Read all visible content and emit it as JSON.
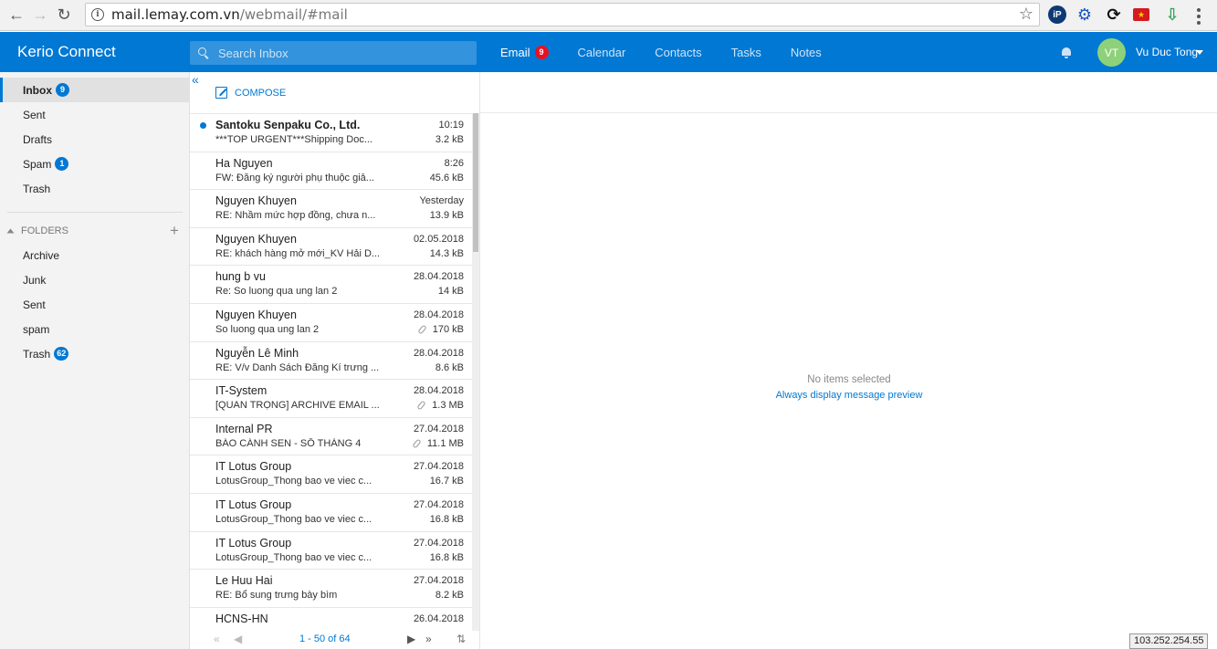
{
  "browser": {
    "url_host": "mail.lemay.com.vn",
    "url_path": "/webmail/#mail",
    "ext_ip_label": "iP"
  },
  "header": {
    "brand": "Kerio Connect",
    "search_placeholder": "Search Inbox",
    "tabs": [
      {
        "label": "Email",
        "badge": "9"
      },
      {
        "label": "Calendar"
      },
      {
        "label": "Contacts"
      },
      {
        "label": "Tasks"
      },
      {
        "label": "Notes"
      }
    ],
    "avatar_initials": "VT",
    "user_name": "Vu Duc Tong",
    "accent_color": "#0078d4"
  },
  "sidebar": {
    "mailboxes": [
      {
        "label": "Inbox",
        "badge": "9"
      },
      {
        "label": "Sent"
      },
      {
        "label": "Drafts"
      },
      {
        "label": "Spam",
        "badge": "1"
      },
      {
        "label": "Trash"
      }
    ],
    "folders_header": "FOLDERS",
    "folders": [
      {
        "label": "Archive"
      },
      {
        "label": "Junk"
      },
      {
        "label": "Sent"
      },
      {
        "label": "spam"
      },
      {
        "label": "Trash",
        "badge": "62"
      }
    ]
  },
  "list": {
    "compose_label": "COMPOSE",
    "messages": [
      {
        "from": "Santoku Senpaku Co., Ltd.",
        "subject": "***TOP URGENT***Shipping Doc...",
        "date": "10:19",
        "size": "3.2 kB",
        "unread": true
      },
      {
        "from": "Ha Nguyen",
        "subject": "FW: Đăng ký người phụ thuộc giả...",
        "date": "8:26",
        "size": "45.6 kB"
      },
      {
        "from": "Nguyen Khuyen",
        "subject": "RE: Nhầm mức hợp đồng, chưa n...",
        "date": "Yesterday",
        "size": "13.9 kB"
      },
      {
        "from": "Nguyen Khuyen",
        "subject": "RE: khách hàng mở mới_KV Hải D...",
        "date": "02.05.2018",
        "size": "14.3 kB"
      },
      {
        "from": "hung b vu",
        "subject": "Re: So luong qua ung lan 2",
        "date": "28.04.2018",
        "size": "14 kB"
      },
      {
        "from": "Nguyen Khuyen",
        "subject": "So luong qua ung lan 2",
        "date": "28.04.2018",
        "size": "170 kB",
        "attachment": true
      },
      {
        "from": "Nguyễn Lê Minh",
        "subject": "RE: V/v Danh Sách Đăng Kí trưng ...",
        "date": "28.04.2018",
        "size": "8.6 kB"
      },
      {
        "from": "IT-System",
        "subject": "[QUAN TRỌNG] ARCHIVE EMAIL ...",
        "date": "28.04.2018",
        "size": "1.3 MB",
        "attachment": true
      },
      {
        "from": "Internal PR",
        "subject": "BÁO CÁNH SEN - SỐ THÁNG 4",
        "date": "27.04.2018",
        "size": "11.1 MB",
        "attachment": true
      },
      {
        "from": "IT Lotus Group",
        "subject": "LotusGroup_Thong bao ve viec c...",
        "date": "27.04.2018",
        "size": "16.7 kB"
      },
      {
        "from": "IT Lotus Group",
        "subject": "LotusGroup_Thong bao ve viec c...",
        "date": "27.04.2018",
        "size": "16.8 kB"
      },
      {
        "from": "IT Lotus Group",
        "subject": "LotusGroup_Thong bao ve viec c...",
        "date": "27.04.2018",
        "size": "16.8 kB"
      },
      {
        "from": "Le Huu Hai",
        "subject": "RE: Bổ sung trưng bày bìm",
        "date": "27.04.2018",
        "size": "8.2 kB"
      },
      {
        "from": "HCNS-HN",
        "subject": "",
        "date": "26.04.2018",
        "size": ""
      }
    ],
    "pager_label": "1 - 50 of 64"
  },
  "preview": {
    "empty_text": "No items selected",
    "link_text": "Always display message preview"
  },
  "status": {
    "ip": "103.252.254.55"
  }
}
